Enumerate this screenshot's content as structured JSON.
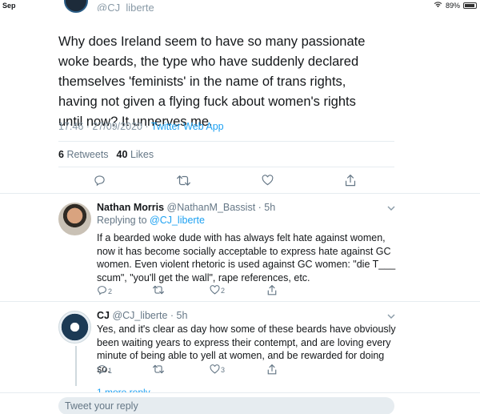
{
  "status_bar": {
    "time": "Sep",
    "battery": "89%"
  },
  "tweet": {
    "author_handle": "@CJ_liberte",
    "text": "Why does Ireland seem to have so many passionate woke beards, the type who have suddenly declared themselves 'feminists' in the name of trans rights, having not given a flying fuck about women's rights until now? It unnerves me.",
    "timestamp": "17:46 · 27/09/2020 · ",
    "source_app": "Twitter Web App",
    "retweets_count": "6",
    "retweets_label": "Retweets",
    "likes_count": "40",
    "likes_label": "Likes"
  },
  "replies": [
    {
      "name": "Nathan Morris",
      "handle_time": "@NathanM_Bassist · 5h",
      "replying_prefix": "Replying to ",
      "replying_to": "@CJ_liberte",
      "text": "If a bearded woke dude with has always felt hate against women, now it has become socially acceptable to express hate against GC women. Even violent rhetoric is used against GC women: \"die T___ scum\", \"you'll get the wall\", rape references, etc.",
      "reply_count": "2",
      "like_count": "2"
    },
    {
      "name": "CJ",
      "handle_time": "@CJ_liberte · 5h",
      "text": "Yes, and it's clear as day how some of these beards have obviously been waiting years to express their contempt, and are loving every minute of being able to yell at women, and be rewarded for doing so.",
      "reply_count": "1",
      "like_count": "3"
    }
  ],
  "more_replies": "1 more reply",
  "composer": {
    "placeholder": "Tweet your reply"
  },
  "icons": [
    "wifi-icon",
    "battery-icon",
    "reply-icon",
    "retweet-icon",
    "like-icon",
    "share-icon",
    "chevron-down-icon"
  ],
  "colors": {
    "link": "#1da1f2",
    "muted": "#657786",
    "divider": "#e6ecf0"
  }
}
